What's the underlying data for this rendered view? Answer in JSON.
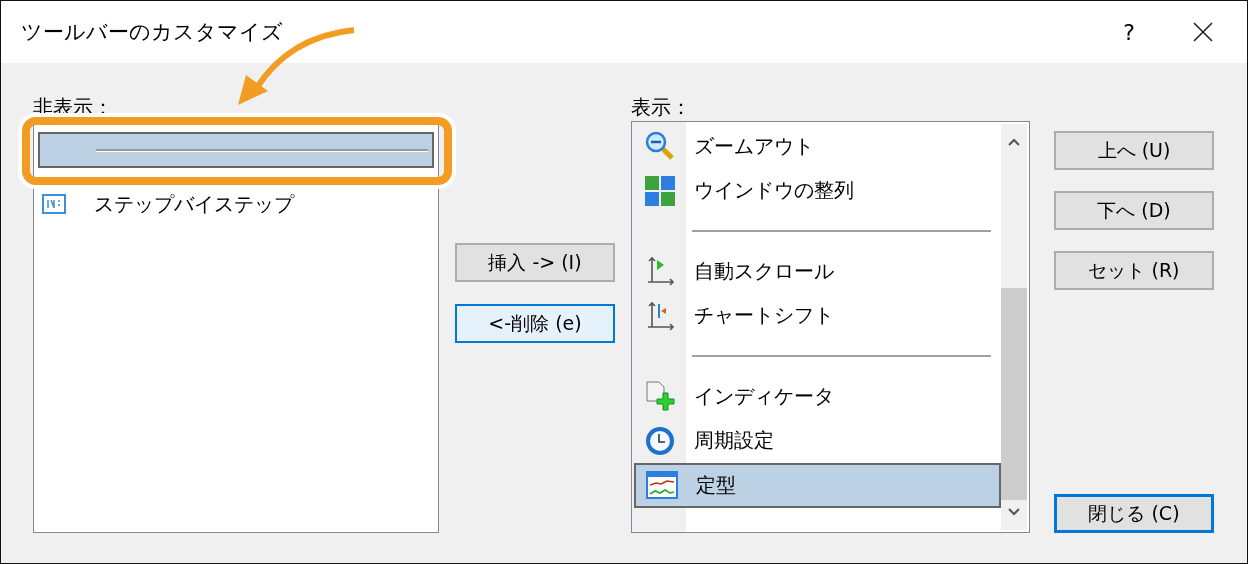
{
  "window": {
    "title": "ツールバーのカスタマイズ",
    "help": "?"
  },
  "hidden": {
    "label": "非表示：",
    "items": [
      {
        "kind": "separator",
        "selected": true
      },
      {
        "kind": "item",
        "label": "ステップバイステップ",
        "selected": false
      }
    ]
  },
  "middle_buttons": [
    {
      "label": "挿入 -> (I)",
      "focused": false
    },
    {
      "label": "<-削除 (e)",
      "focused": true
    }
  ],
  "shown": {
    "label": "表示：",
    "items": [
      {
        "kind": "item",
        "label": "ズームアウト",
        "selected": false
      },
      {
        "kind": "item",
        "label": "ウインドウの整列",
        "selected": false
      },
      {
        "kind": "separator",
        "selected": false
      },
      {
        "kind": "item",
        "label": "自動スクロール",
        "selected": false
      },
      {
        "kind": "item",
        "label": "チャートシフト",
        "selected": false
      },
      {
        "kind": "separator",
        "selected": false
      },
      {
        "kind": "item",
        "label": "インディケータ",
        "selected": false
      },
      {
        "kind": "item",
        "label": "周期設定",
        "selected": false
      },
      {
        "kind": "item",
        "label": "定型",
        "selected": true
      }
    ]
  },
  "side_buttons": [
    {
      "label": "上へ (U)",
      "focused": false
    },
    {
      "label": "下へ (D)",
      "focused": false
    },
    {
      "label": "セット (R)",
      "focused": false
    }
  ],
  "close_button": {
    "label": "閉じる (C)",
    "focused": true
  }
}
